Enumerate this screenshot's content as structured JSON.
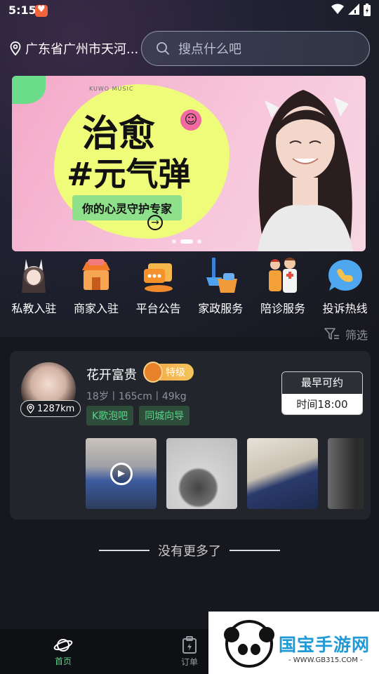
{
  "status_bar": {
    "time": "5:15",
    "icons": [
      "wifi-icon",
      "signal-icon",
      "battery-icon"
    ]
  },
  "header": {
    "location": "广东省广州市天河...",
    "search_placeholder": "搜点什么吧"
  },
  "banner": {
    "brand": "KUWO MUSIC",
    "title_line1": "治愈",
    "title_line2": "#元气弹",
    "subtitle": "你的心灵守护专家",
    "page_count": 3,
    "active_page": 2
  },
  "categories": [
    {
      "label": "私教入驻",
      "icon": "trainer-icon"
    },
    {
      "label": "商家入驻",
      "icon": "shop-icon"
    },
    {
      "label": "平台公告",
      "icon": "announcement-icon"
    },
    {
      "label": "家政服务",
      "icon": "housekeeping-icon"
    },
    {
      "label": "陪诊服务",
      "icon": "escort-icon"
    },
    {
      "label": "投诉热线",
      "icon": "hotline-icon"
    }
  ],
  "filter": {
    "label": "筛选"
  },
  "card": {
    "name": "花开富贵",
    "level": "特级",
    "distance": "1287km",
    "stats": "18岁丨165cm丨49kg",
    "tags": [
      "K歌泡吧",
      "同城向导"
    ],
    "avail_title": "最早可约",
    "avail_time": "时间18:00"
  },
  "end_text": "没有更多了",
  "bottom_nav": [
    {
      "label": "首页",
      "active": true
    },
    {
      "label": "订单",
      "active": false
    },
    {
      "label": "",
      "active": false
    }
  ],
  "watermark": {
    "title": "国宝手游网",
    "url": "- WWW.GB315.COM -"
  },
  "colors": {
    "accent_green": "#5ed18b",
    "level_orange": "#f0a446",
    "background": "#17181d"
  }
}
